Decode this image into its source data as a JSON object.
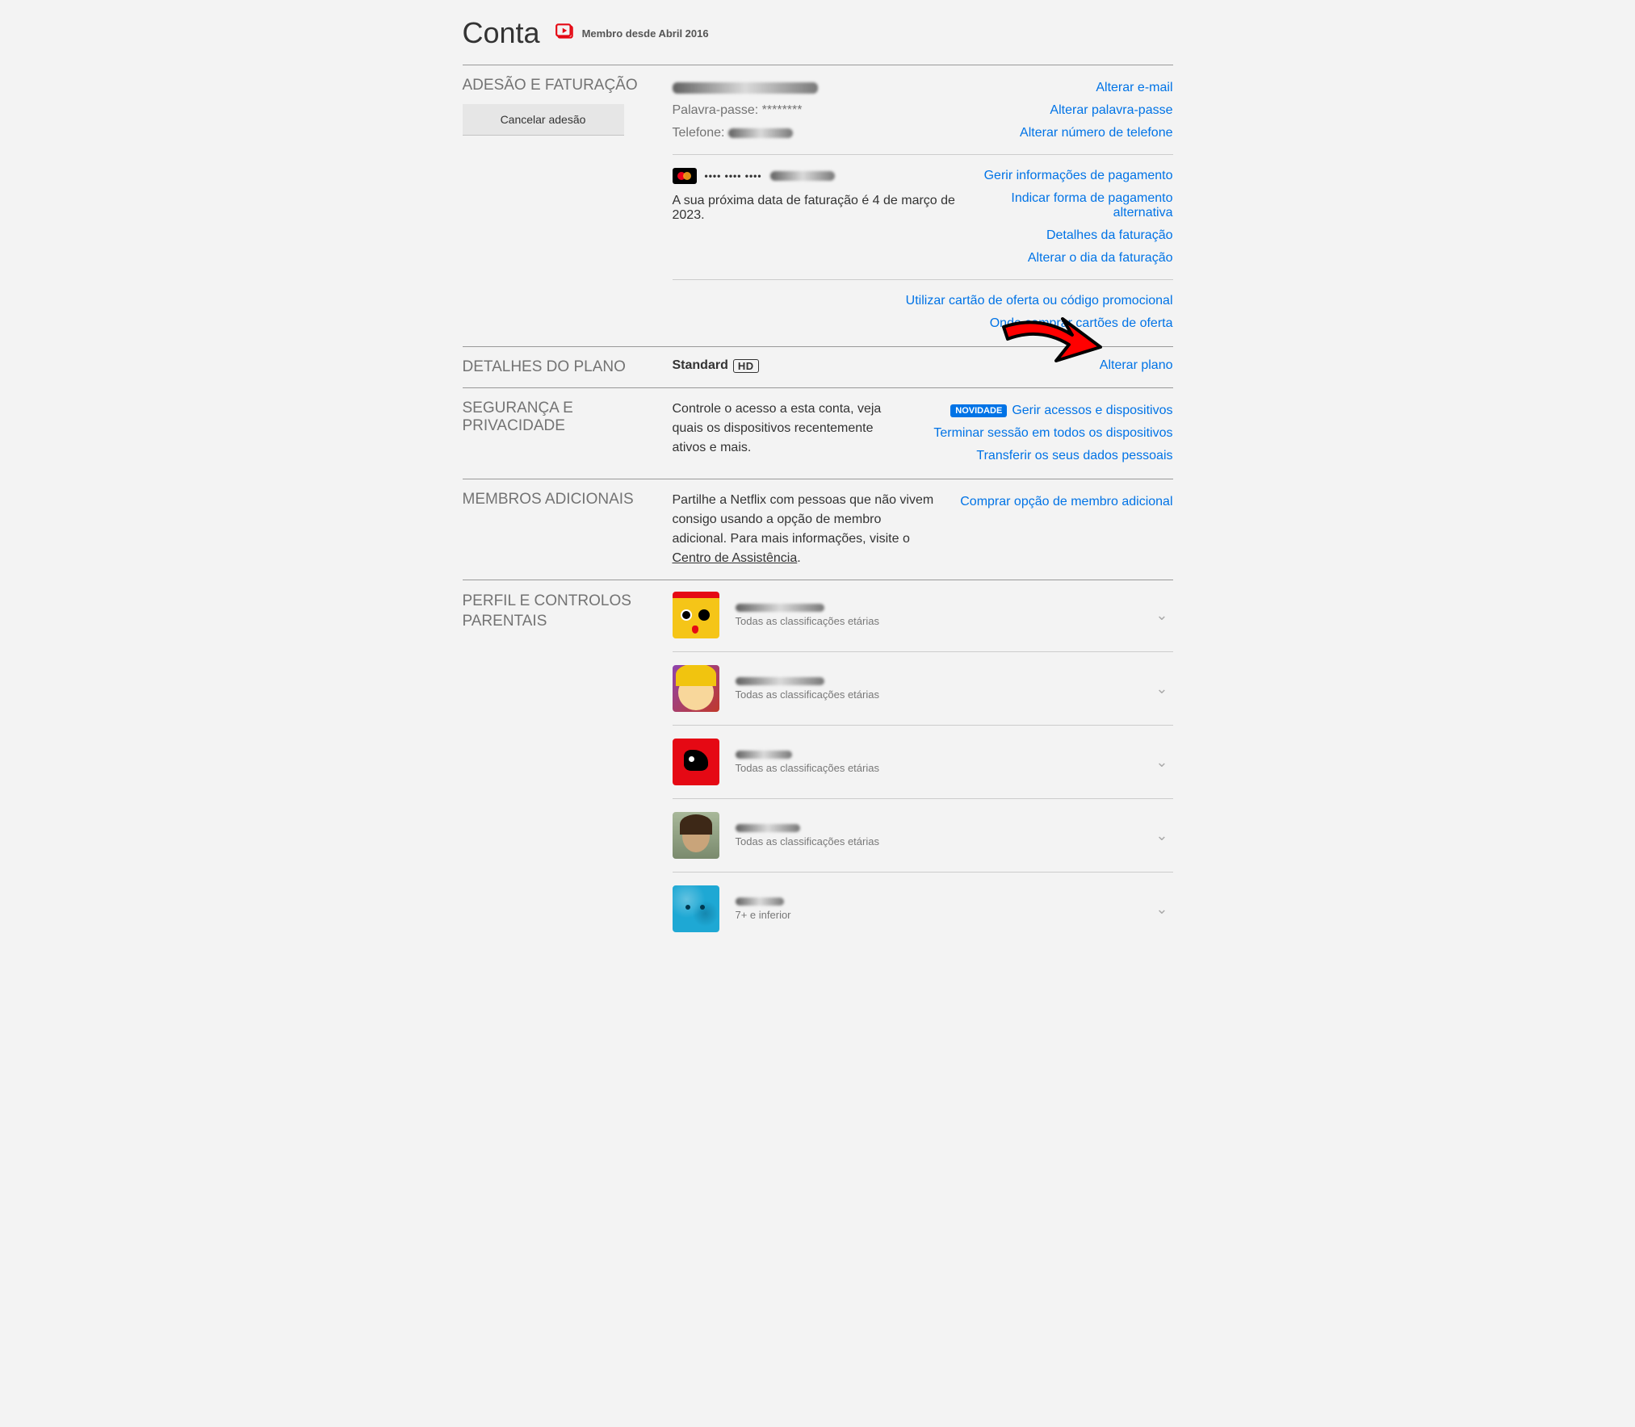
{
  "header": {
    "title": "Conta",
    "member_since": "Membro desde Abril 2016"
  },
  "membership": {
    "label": "ADESÃO E FATURAÇÃO",
    "cancel_button": "Cancelar adesão",
    "email": "[redacted]",
    "password_label": "Palavra-passe: ",
    "password_value": "********",
    "phone_label": "Telefone: ",
    "phone_value": "[redacted]",
    "links": {
      "change_email": "Alterar e-mail",
      "change_password": "Alterar palavra-passe",
      "change_phone": "Alterar número de telefone"
    },
    "card_masked": "•••• •••• ••••",
    "card_last": "[redacted]",
    "billing_text": "A sua próxima data de faturação é 4 de março de 2023.",
    "payment_links": {
      "manage_payment": "Gerir informações de pagamento",
      "alt_payment": "Indicar forma de pagamento alternativa",
      "billing_details": "Detalhes da faturação",
      "change_billing_day": "Alterar o dia da faturação"
    },
    "gift_links": {
      "redeem": "Utilizar cartão de oferta ou código promocional",
      "where_buy": "Onde comprar cartões de oferta"
    }
  },
  "plan": {
    "label": "DETALHES DO PLANO",
    "name": "Standard",
    "quality_badge": "HD",
    "change_link": "Alterar plano"
  },
  "security": {
    "label": "SEGURANÇA E PRIVACIDADE",
    "description": "Controle o acesso a esta conta, veja quais os dispositivos recentemente ativos e mais.",
    "badge": "NOVIDADE",
    "links": {
      "manage_access": "Gerir acessos e dispositivos",
      "signout_all": "Terminar sessão em todos os dispositivos",
      "transfer_data": "Transferir os seus dados pessoais"
    }
  },
  "extra_members": {
    "label": "MEMBROS ADICIONAIS",
    "description_prefix": "Partilhe a Netflix com pessoas que não vivem consigo usando a opção de membro adicional. Para mais informações, visite o ",
    "help_link": "Centro de Assistência",
    "description_suffix": ".",
    "buy_link": "Comprar opção de membro adicional"
  },
  "profiles": {
    "label": "PERFIL E CONTROLOS PARENTAIS",
    "items": [
      {
        "name": "[redacted]",
        "rating": "Todas as classificações etárias"
      },
      {
        "name": "[redacted]",
        "rating": "Todas as classificações etárias"
      },
      {
        "name": "[redacted]",
        "rating": "Todas as classificações etárias"
      },
      {
        "name": "[redacted]",
        "rating": "Todas as classificações etárias"
      },
      {
        "name": "[redacted]",
        "rating": "7+ e inferior"
      }
    ]
  }
}
